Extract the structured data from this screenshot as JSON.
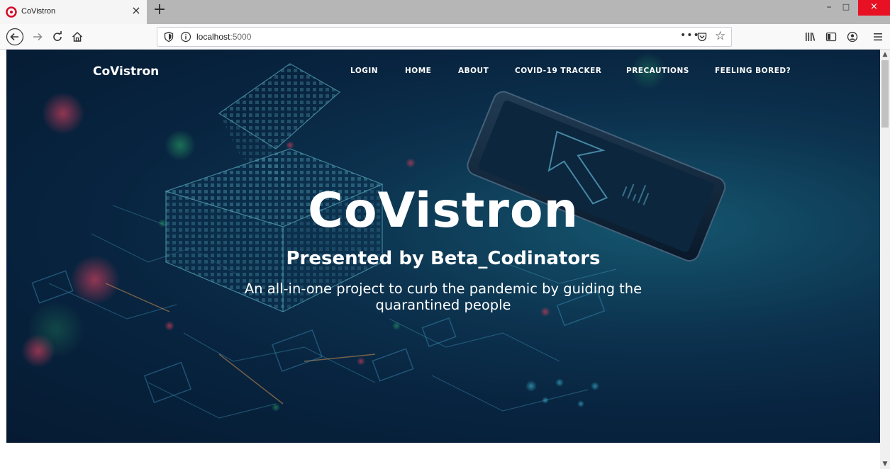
{
  "browser": {
    "tab_title": "CoVistron",
    "tab_close": "×",
    "new_tab": "+",
    "url_host": "localhost",
    "url_port": ":5000",
    "url_more": "•••",
    "star": "☆",
    "win_min": "–",
    "win_max": "□",
    "win_close": "×"
  },
  "nav": {
    "brand": "CoVistron",
    "items": [
      "LOGIN",
      "HOME",
      "ABOUT",
      "COVID-19 TRACKER",
      "PRECAUTIONS",
      "FEELING BORED?"
    ]
  },
  "hero": {
    "title": "CoVistron",
    "subtitle": "Presented by Beta_Codinators",
    "description": "An all-in-one project to curb the pandemic by guiding the quarantined people"
  },
  "colors": {
    "hero_dark": "#071d36",
    "hero_teal": "#1b6c86",
    "close_red": "#e81123",
    "favicon_red": "#d70022"
  },
  "icons": [
    "back-icon",
    "forward-icon",
    "reload-icon",
    "home-icon",
    "shield-icon",
    "info-icon",
    "pocket-icon",
    "bookmark-star-icon",
    "library-icon",
    "sidebar-icon",
    "account-icon",
    "menu-icon"
  ]
}
